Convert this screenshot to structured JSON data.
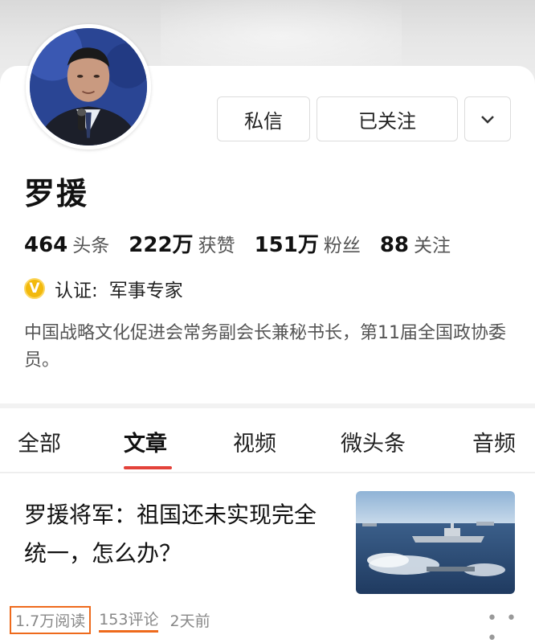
{
  "profile": {
    "name": "罗援",
    "buttons": {
      "message": "私信",
      "follow": "已关注",
      "more_icon": "chevron-down-icon"
    },
    "stats": [
      {
        "value": "464",
        "label": "头条"
      },
      {
        "value": "222万",
        "label": "获赞"
      },
      {
        "value": "151万",
        "label": "粉丝"
      },
      {
        "value": "88",
        "label": "关注"
      }
    ],
    "certification": {
      "badge": "V",
      "label": "认证:",
      "value": "军事专家",
      "badge_color": "#f2b90c"
    },
    "bio": "中国战略文化促进会常务副会长兼秘书长，第11届全国政协委员。"
  },
  "tabs": [
    {
      "label": "全部",
      "active": false
    },
    {
      "label": "文章",
      "active": true
    },
    {
      "label": "视频",
      "active": false
    },
    {
      "label": "微头条",
      "active": false
    },
    {
      "label": "音频",
      "active": false
    }
  ],
  "articles": [
    {
      "title": "罗援将军：祖国还未实现完全统一，怎么办？",
      "reads": "1.7万阅读",
      "comments": "153评论",
      "time": "2天前",
      "more_icon": "more-dots-icon"
    }
  ],
  "colors": {
    "accent": "#e3423a",
    "highlight": "#ee6a1c"
  }
}
